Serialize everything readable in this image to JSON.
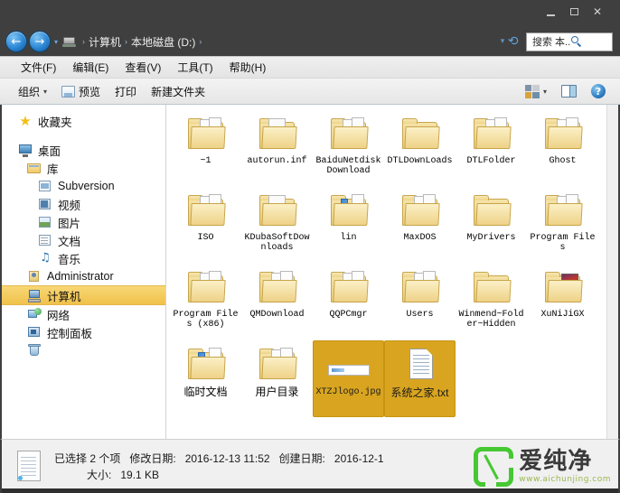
{
  "window": {
    "minimize_label": "–",
    "maximize_label": "□",
    "close_label": "✕"
  },
  "address_bar": {
    "back_label": "←",
    "forward_label": "→",
    "history_caret": "▾",
    "crumbs": [
      "计算机",
      "本地磁盘 (D:)"
    ],
    "separator": "›",
    "trailing_separator": "›",
    "dropdown_caret": "▾",
    "refresh_label": "⟳"
  },
  "search": {
    "value": "搜索 本...",
    "placeholder": "搜索 本地磁盘 (D:)"
  },
  "menubar": {
    "items": [
      {
        "label": "文件(F)"
      },
      {
        "label": "编辑(E)"
      },
      {
        "label": "查看(V)"
      },
      {
        "label": "工具(T)"
      },
      {
        "label": "帮助(H)"
      }
    ]
  },
  "toolbar": {
    "organize_label": "组织",
    "organize_caret": "▾",
    "preview_label": "预览",
    "print_label": "打印",
    "new_folder_label": "新建文件夹",
    "view_caret": "▾",
    "help_label": "?"
  },
  "sidebar": {
    "items": [
      {
        "label": "收藏夹",
        "icon": "star-icon",
        "level": 0,
        "selected": false
      },
      {
        "label": "桌面",
        "icon": "monitor-icon",
        "level": 0,
        "selected": false
      },
      {
        "label": "库",
        "icon": "library-icon",
        "level": 1,
        "selected": false
      },
      {
        "label": "Subversion",
        "icon": "subversion-icon",
        "level": 2,
        "selected": false
      },
      {
        "label": "视频",
        "icon": "video-icon",
        "level": 2,
        "selected": false
      },
      {
        "label": "图片",
        "icon": "picture-icon",
        "level": 2,
        "selected": false
      },
      {
        "label": "文档",
        "icon": "document-icon",
        "level": 2,
        "selected": false
      },
      {
        "label": "音乐",
        "icon": "music-icon",
        "level": 2,
        "selected": false
      },
      {
        "label": "Administrator",
        "icon": "user-icon",
        "level": 1,
        "selected": false
      },
      {
        "label": "计算机",
        "icon": "computer-icon",
        "level": 1,
        "selected": true
      },
      {
        "label": "网络",
        "icon": "network-icon",
        "level": 1,
        "selected": false
      },
      {
        "label": "控制面板",
        "icon": "control-panel-icon",
        "level": 1,
        "selected": false
      },
      {
        "label": "",
        "icon": "recycle-bin-icon",
        "level": 1,
        "selected": false
      }
    ]
  },
  "files": {
    "items": [
      {
        "name": "~1",
        "type": "folder",
        "variant": "papers",
        "selected": false,
        "cjk": false
      },
      {
        "name": "autorun.inf",
        "type": "folder",
        "variant": "docs",
        "selected": false,
        "cjk": false
      },
      {
        "name": "BaiduNetdiskDownload",
        "type": "folder",
        "variant": "papers",
        "selected": false,
        "cjk": false
      },
      {
        "name": "DTLDownLoads",
        "type": "folder",
        "variant": "plain",
        "selected": false,
        "cjk": false
      },
      {
        "name": "DTLFolder",
        "type": "folder",
        "variant": "papers",
        "selected": false,
        "cjk": false
      },
      {
        "name": "Ghost",
        "type": "folder",
        "variant": "papers",
        "selected": false,
        "cjk": false
      },
      {
        "name": "ISO",
        "type": "folder",
        "variant": "papers",
        "selected": false,
        "cjk": false
      },
      {
        "name": "KDubaSoftDownloads",
        "type": "folder",
        "variant": "green",
        "selected": false,
        "cjk": false
      },
      {
        "name": "lin",
        "type": "folder",
        "variant": "blue",
        "selected": false,
        "cjk": false
      },
      {
        "name": "MaxDOS",
        "type": "folder",
        "variant": "papers",
        "selected": false,
        "cjk": false
      },
      {
        "name": "MyDrivers",
        "type": "folder",
        "variant": "plain",
        "selected": false,
        "cjk": false
      },
      {
        "name": "Program Files",
        "type": "folder",
        "variant": "papers",
        "selected": false,
        "cjk": false
      },
      {
        "name": "Program Files (x86)",
        "type": "folder",
        "variant": "papers",
        "selected": false,
        "cjk": false
      },
      {
        "name": "QMDownload",
        "type": "folder",
        "variant": "papers",
        "selected": false,
        "cjk": false
      },
      {
        "name": "QQPCmgr",
        "type": "folder",
        "variant": "papers",
        "selected": false,
        "cjk": false
      },
      {
        "name": "Users",
        "type": "folder",
        "variant": "papers",
        "selected": false,
        "cjk": false
      },
      {
        "name": "Winmend~Folder~Hidden",
        "type": "folder",
        "variant": "plain",
        "selected": false,
        "cjk": false
      },
      {
        "name": "XuNiJiGX",
        "type": "folder",
        "variant": "photo",
        "selected": false,
        "cjk": false
      },
      {
        "name": "临时文档",
        "type": "folder",
        "variant": "blue",
        "selected": false,
        "cjk": true
      },
      {
        "name": "用户目录",
        "type": "folder",
        "variant": "papers",
        "selected": false,
        "cjk": true
      },
      {
        "name": "XTZJlogo.jpg",
        "type": "image",
        "variant": "jpg",
        "selected": true,
        "cjk": false
      },
      {
        "name": "系统之家.txt",
        "type": "text",
        "variant": "txt",
        "selected": true,
        "cjk": true
      }
    ]
  },
  "statusbar": {
    "selection": "已选择  2  个项",
    "modified_label": "修改日期:",
    "modified_value": "2016-12-13 11:52",
    "created_label": "创建日期:",
    "created_value": "2016-12-1",
    "size_label": "大小:",
    "size_value": "19.1 KB"
  },
  "watermark": {
    "brand": "爱纯净",
    "url": "www.aichunjing.com"
  }
}
